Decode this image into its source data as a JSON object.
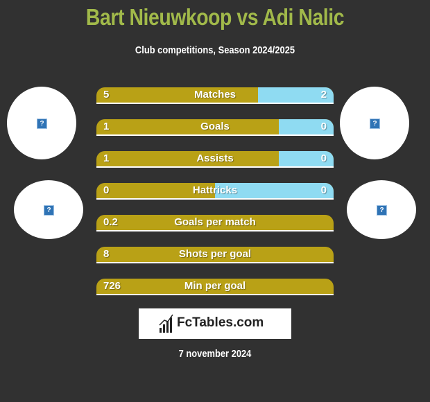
{
  "header": {
    "title": "Bart Nieuwkoop vs Adi Nalic",
    "subtitle": "Club competitions, Season 2024/2025"
  },
  "colors": {
    "left": "#b9a116",
    "right": "#8fdbf2",
    "title": "#a1b94a",
    "background": "#313131"
  },
  "stats": [
    {
      "label": "Matches",
      "left": "5",
      "right": "2",
      "right_share": 0.32
    },
    {
      "label": "Goals",
      "left": "1",
      "right": "0",
      "right_share": 0.23
    },
    {
      "label": "Assists",
      "left": "1",
      "right": "0",
      "right_share": 0.23
    },
    {
      "label": "Hattricks",
      "left": "0",
      "right": "0",
      "right_share": 0.5
    },
    {
      "label": "Goals per match",
      "left": "0.2",
      "right": "",
      "right_share": 0
    },
    {
      "label": "Shots per goal",
      "left": "8",
      "right": "",
      "right_share": 0
    },
    {
      "label": "Min per goal",
      "left": "726",
      "right": "",
      "right_share": 0
    }
  ],
  "avatars": {
    "placeholder_glyph": "?"
  },
  "logo": {
    "text": "FcTables.com"
  },
  "footer": {
    "date": "7 november 2024"
  }
}
